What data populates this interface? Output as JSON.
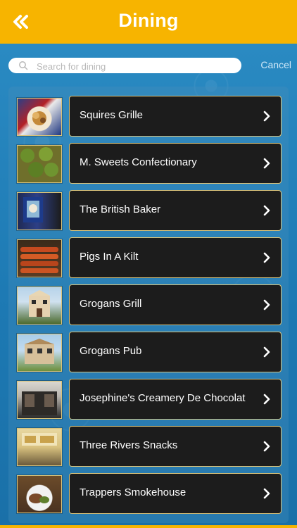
{
  "header": {
    "title": "Dining"
  },
  "search": {
    "placeholder": "Search for dining",
    "value": "",
    "cancel_label": "Cancel"
  },
  "items": [
    {
      "label": "Squires Grille"
    },
    {
      "label": "M. Sweets Confectionary"
    },
    {
      "label": "The British Baker"
    },
    {
      "label": "Pigs In A Kilt"
    },
    {
      "label": "Grogans Grill"
    },
    {
      "label": "Grogans Pub"
    },
    {
      "label": "Josephine's Creamery De Chocolat"
    },
    {
      "label": "Three Rivers Snacks"
    },
    {
      "label": "Trappers Smokehouse"
    }
  ],
  "colors": {
    "accent": "#f7b400",
    "background": "#1f7fb8",
    "row": "#1c1c1c"
  }
}
